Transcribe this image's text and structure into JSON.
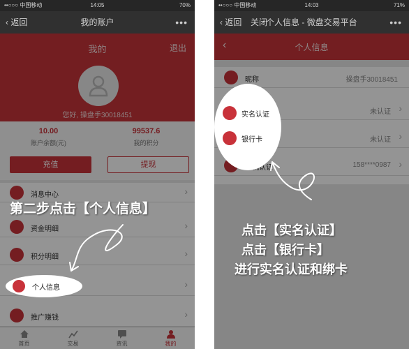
{
  "left_phone": {
    "status": {
      "carrier": "••○○○ 中国移动",
      "time": "14:05",
      "battery": "70%"
    },
    "nav": {
      "back": "返回",
      "title": "我的账户",
      "more": "•••"
    },
    "hero": {
      "title": "我的",
      "logout": "退出",
      "greeting": "您好, 操盘手30018451"
    },
    "stats": [
      {
        "value": "10.00",
        "label": "账户余额(元)"
      },
      {
        "value": "99537.6",
        "label": "我的积分"
      }
    ],
    "buttons": {
      "recharge": "充值",
      "withdraw": "提现"
    },
    "menu": [
      {
        "label": "消息中心",
        "icon": "message-icon"
      },
      {
        "label": "资金明细",
        "icon": "yen-icon"
      },
      {
        "label": "积分明细",
        "icon": "points-icon"
      },
      {
        "label": "个人信息",
        "icon": "person-icon"
      },
      {
        "label": "推广赚钱",
        "icon": "megaphone-icon"
      }
    ],
    "tabs": [
      {
        "label": "首页",
        "icon": "home-icon"
      },
      {
        "label": "交易",
        "icon": "trade-icon"
      },
      {
        "label": "资讯",
        "icon": "news-icon"
      },
      {
        "label": "我的",
        "icon": "user-icon"
      }
    ],
    "caption": "第二步点击【个人信息】"
  },
  "right_phone": {
    "status": {
      "carrier": "••○○○ 中国移动",
      "time": "14:03",
      "battery": "71%"
    },
    "nav": {
      "back": "返回",
      "close": "关闭",
      "title": "个人信息 - 微盘交易平台",
      "more": "•••"
    },
    "subnav": {
      "title": "个人信息"
    },
    "rows": [
      {
        "label": "昵称",
        "value": "操盘手30018451",
        "icon": "person-icon"
      },
      {
        "label": "实名认证",
        "value": "未认证",
        "icon": "verify-icon"
      },
      {
        "label": "银行卡",
        "value": "未认证",
        "icon": "card-icon"
      },
      {
        "label": "手机认证",
        "value": "158****0987",
        "icon": "phone-icon"
      }
    ],
    "caption_lines": [
      "点击【实名认证】",
      "点击【银行卡】",
      "进行实名认证和绑卡"
    ]
  },
  "colors": {
    "accent": "#c8323a",
    "navbar": "#303030",
    "statusbar": "#262626"
  }
}
